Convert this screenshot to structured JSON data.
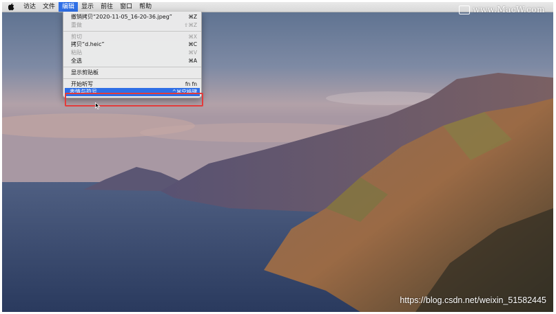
{
  "menubar": {
    "items": [
      {
        "label": "访达"
      },
      {
        "label": "文件"
      },
      {
        "label": "编辑"
      },
      {
        "label": "显示"
      },
      {
        "label": "前往"
      },
      {
        "label": "窗口"
      },
      {
        "label": "帮助"
      }
    ],
    "active_index": 2
  },
  "edit_menu": {
    "items": [
      {
        "label": "撤销拷贝“2020-11-05_16-20-36.jpeg”",
        "shortcut": "⌘Z",
        "disabled": false
      },
      {
        "label": "重做",
        "shortcut": "⇧⌘Z",
        "disabled": true
      },
      {
        "label": "剪切",
        "shortcut": "⌘X",
        "disabled": true
      },
      {
        "label": "拷贝“d.heic”",
        "shortcut": "⌘C",
        "disabled": false
      },
      {
        "label": "粘贴",
        "shortcut": "⌘V",
        "disabled": true
      },
      {
        "label": "全选",
        "shortcut": "⌘A",
        "disabled": false
      },
      {
        "label": "显示剪贴板",
        "shortcut": "",
        "disabled": false
      },
      {
        "label": "开始听写",
        "shortcut": "fn fn",
        "disabled": false
      },
      {
        "label": "表情与符号",
        "shortcut": "^⌘空格键",
        "disabled": false,
        "highlighted": true
      }
    ]
  },
  "watermarks": {
    "macw": "www.MacW.com",
    "csdn": "https://blog.csdn.net/weixin_51582445"
  },
  "colors": {
    "menu_highlight": "#2f6fe6",
    "annotation_box": "#e23b3b"
  }
}
